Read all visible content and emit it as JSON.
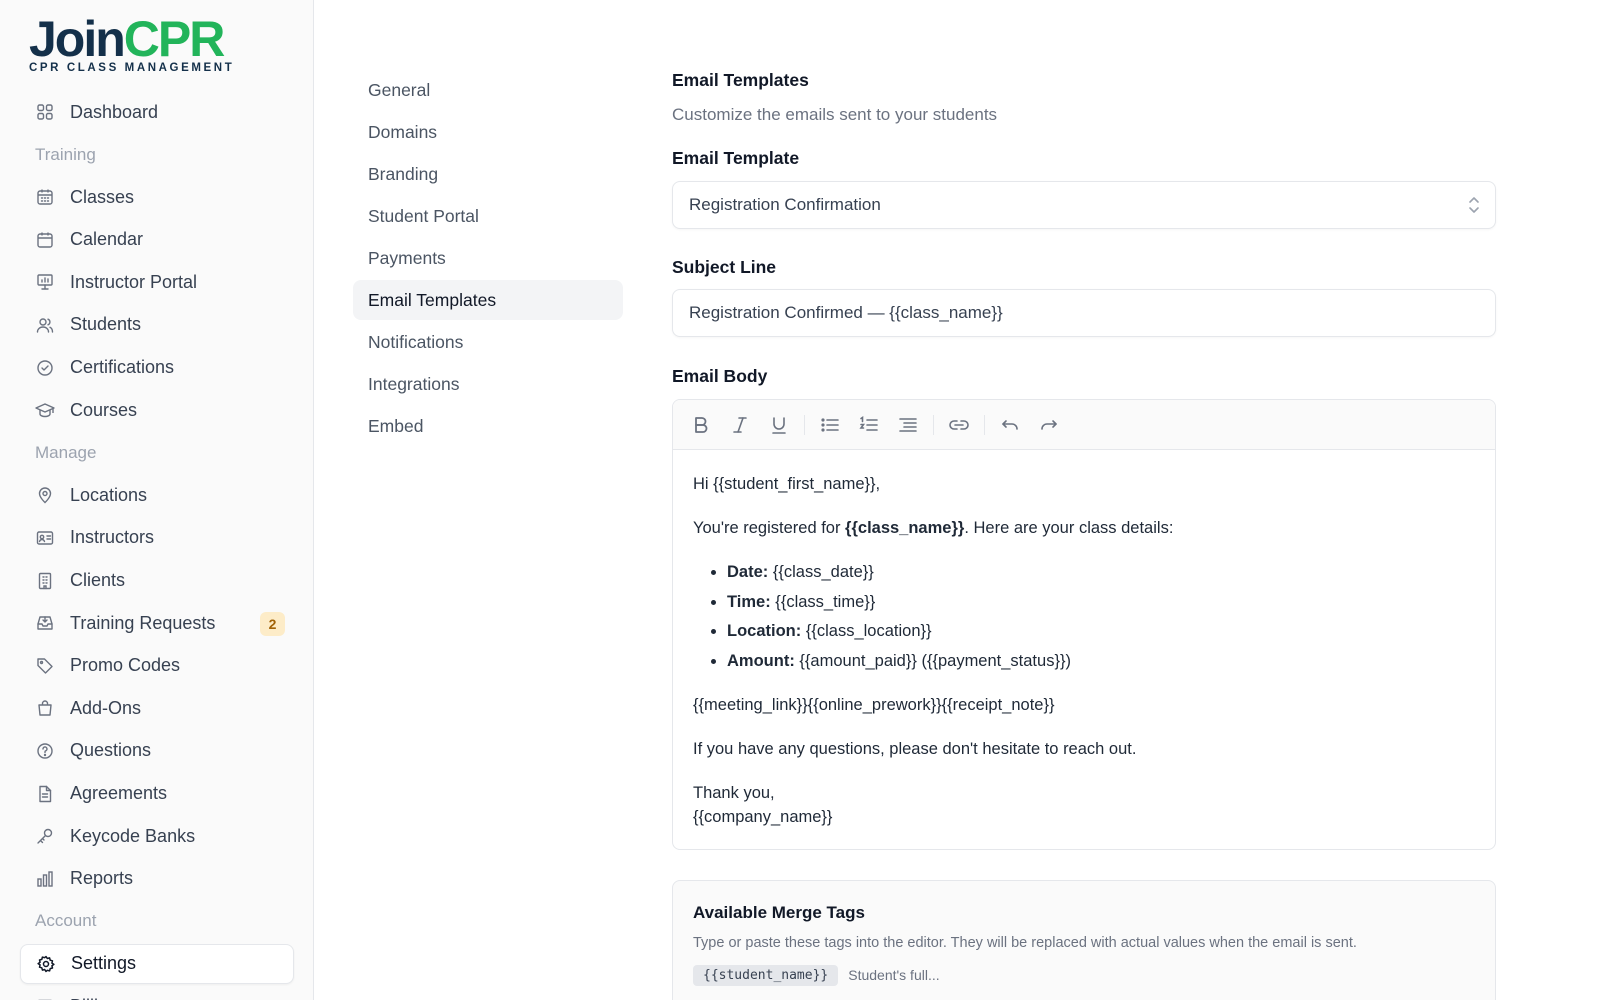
{
  "brand": {
    "name_part1": "Join",
    "name_part2": "CPR",
    "tagline": "CPR CLASS MANAGEMENT",
    "color_dark": "#14304a",
    "color_green": "#22b45a"
  },
  "sidebar": {
    "items": [
      {
        "type": "item",
        "label": "Dashboard",
        "icon": "grid-icon"
      },
      {
        "type": "section",
        "label": "Training"
      },
      {
        "type": "item",
        "label": "Classes",
        "icon": "calendar-grid-icon"
      },
      {
        "type": "item",
        "label": "Calendar",
        "icon": "calendar-icon"
      },
      {
        "type": "item",
        "label": "Instructor Portal",
        "icon": "presentation-icon"
      },
      {
        "type": "item",
        "label": "Students",
        "icon": "users-icon"
      },
      {
        "type": "item",
        "label": "Certifications",
        "icon": "badge-check-icon"
      },
      {
        "type": "item",
        "label": "Courses",
        "icon": "graduation-cap-icon"
      },
      {
        "type": "section",
        "label": "Manage"
      },
      {
        "type": "item",
        "label": "Locations",
        "icon": "map-pin-icon"
      },
      {
        "type": "item",
        "label": "Instructors",
        "icon": "id-card-icon"
      },
      {
        "type": "item",
        "label": "Clients",
        "icon": "building-icon"
      },
      {
        "type": "item",
        "label": "Training Requests",
        "icon": "inbox-icon",
        "badge": "2"
      },
      {
        "type": "item",
        "label": "Promo Codes",
        "icon": "tag-icon"
      },
      {
        "type": "item",
        "label": "Add-Ons",
        "icon": "shopping-bag-icon"
      },
      {
        "type": "item",
        "label": "Questions",
        "icon": "help-circle-icon"
      },
      {
        "type": "item",
        "label": "Agreements",
        "icon": "file-text-icon"
      },
      {
        "type": "item",
        "label": "Keycode Banks",
        "icon": "key-icon"
      },
      {
        "type": "item",
        "label": "Reports",
        "icon": "bar-chart-icon"
      },
      {
        "type": "section",
        "label": "Account"
      },
      {
        "type": "item",
        "label": "Settings",
        "icon": "gear-icon",
        "active": true
      },
      {
        "type": "item",
        "label": "Billing",
        "icon": "credit-card-icon"
      }
    ]
  },
  "settings_nav": {
    "items": [
      {
        "label": "General"
      },
      {
        "label": "Domains"
      },
      {
        "label": "Branding"
      },
      {
        "label": "Student Portal"
      },
      {
        "label": "Payments"
      },
      {
        "label": "Email Templates",
        "active": true
      },
      {
        "label": "Notifications"
      },
      {
        "label": "Integrations"
      },
      {
        "label": "Embed"
      }
    ]
  },
  "main": {
    "title": "Email Templates",
    "description": "Customize the emails sent to your students",
    "template_field": {
      "label": "Email Template",
      "value": "Registration Confirmation"
    },
    "subject_field": {
      "label": "Subject Line",
      "value": "Registration Confirmed — {{class_name}}"
    },
    "body_field": {
      "label": "Email Body",
      "toolbar": [
        "bold-icon",
        "italic-icon",
        "underline-icon",
        "bullet-list-icon",
        "numbered-list-icon",
        "indent-icon",
        "link-icon",
        "undo-icon",
        "redo-icon"
      ],
      "greeting": "Hi {{student_first_name}},",
      "intro_before": "You're registered for ",
      "intro_bold": "{{class_name}}",
      "intro_after": ". Here are your class details:",
      "details": [
        {
          "label": "Date:",
          "value": " {{class_date}}"
        },
        {
          "label": "Time:",
          "value": " {{class_time}}"
        },
        {
          "label": "Location:",
          "value": " {{class_location}}"
        },
        {
          "label": "Amount:",
          "value": " {{amount_paid}} ({{payment_status}})"
        }
      ],
      "extras": "{{meeting_link}}{{online_prework}}{{receipt_note}}",
      "closing": "If you have any questions, please don't hesitate to reach out.",
      "signoff": "Thank you,",
      "signature": "{{company_name}}"
    },
    "merge_tags": {
      "title": "Available Merge Tags",
      "description": "Type or paste these tags into the editor. They will be replaced with actual values when the email is sent.",
      "first_tag": "{{student_name}}",
      "first_tag_desc": "Student's full..."
    }
  }
}
